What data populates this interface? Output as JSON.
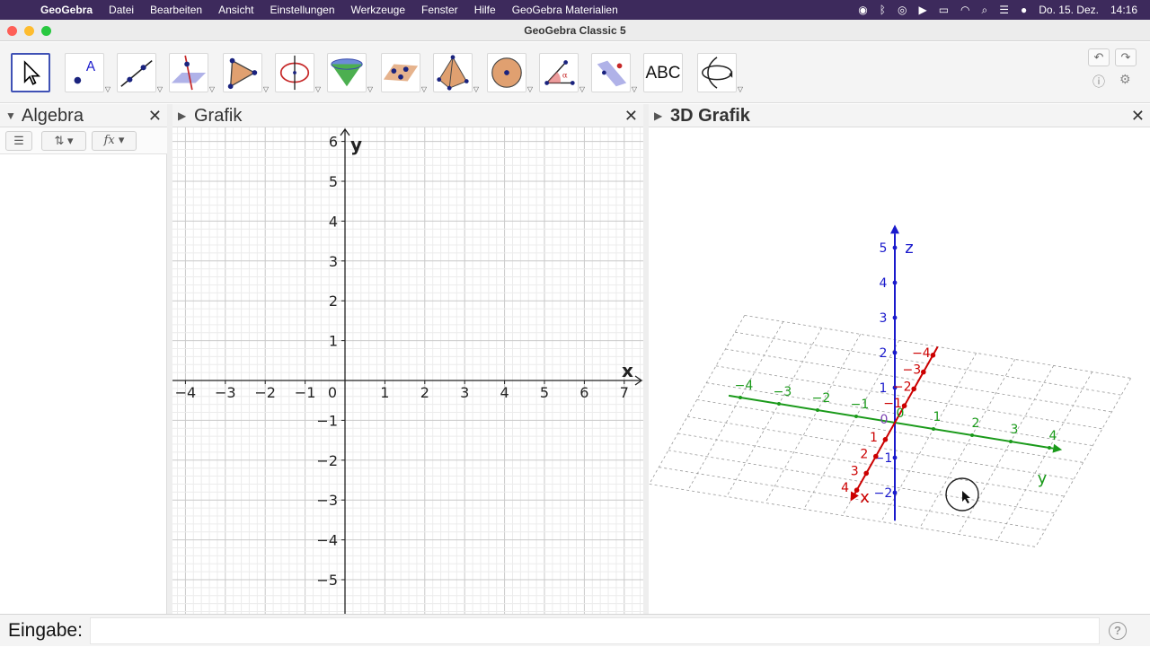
{
  "menubar": {
    "app": "GeoGebra",
    "items": [
      "Datei",
      "Bearbeiten",
      "Ansicht",
      "Einstellungen",
      "Werkzeuge",
      "Fenster",
      "Hilfe",
      "GeoGebra Materialien"
    ],
    "date": "Do. 15. Dez.",
    "time": "14:16"
  },
  "window": {
    "title": "GeoGebra Classic 5"
  },
  "toolbar": {
    "tools": [
      {
        "icon": "move-arrow-icon"
      },
      {
        "icon": "point-icon"
      },
      {
        "icon": "line-icon"
      },
      {
        "icon": "perpendicular-line-icon"
      },
      {
        "icon": "polygon-icon"
      },
      {
        "icon": "circle-axis-icon"
      },
      {
        "icon": "cone-icon"
      },
      {
        "icon": "plane-points-icon"
      },
      {
        "icon": "pyramid-icon"
      },
      {
        "icon": "sphere-icon"
      },
      {
        "icon": "angle-icon"
      },
      {
        "icon": "reflect-plane-icon"
      },
      {
        "icon": "text-tool-icon",
        "label": "ABC"
      },
      {
        "icon": "rotate-view-icon"
      }
    ],
    "undo_icon": "undo-icon",
    "redo_icon": "redo-icon"
  },
  "panels": {
    "algebra": {
      "title": "Algebra",
      "fx_label": "fx"
    },
    "graphics": {
      "title": "Grafik",
      "x_axis_label": "x",
      "y_axis_label": "y",
      "origin_label": "0",
      "x_range": [
        -4,
        7
      ],
      "y_range": [
        -5,
        6
      ]
    },
    "graphics3d": {
      "title": "3D Grafik",
      "z_axis_label": "z",
      "x_axis_label": "x",
      "y_axis_label": "y"
    }
  },
  "input": {
    "label": "Eingabe:",
    "value": ""
  },
  "colors": {
    "menubar": "#3d2a5c",
    "x_axis_3d": "#cc0000",
    "y_axis_3d": "#1a9a1a",
    "z_axis_3d": "#1a1acc",
    "selected_tool": "#3f51b5"
  }
}
